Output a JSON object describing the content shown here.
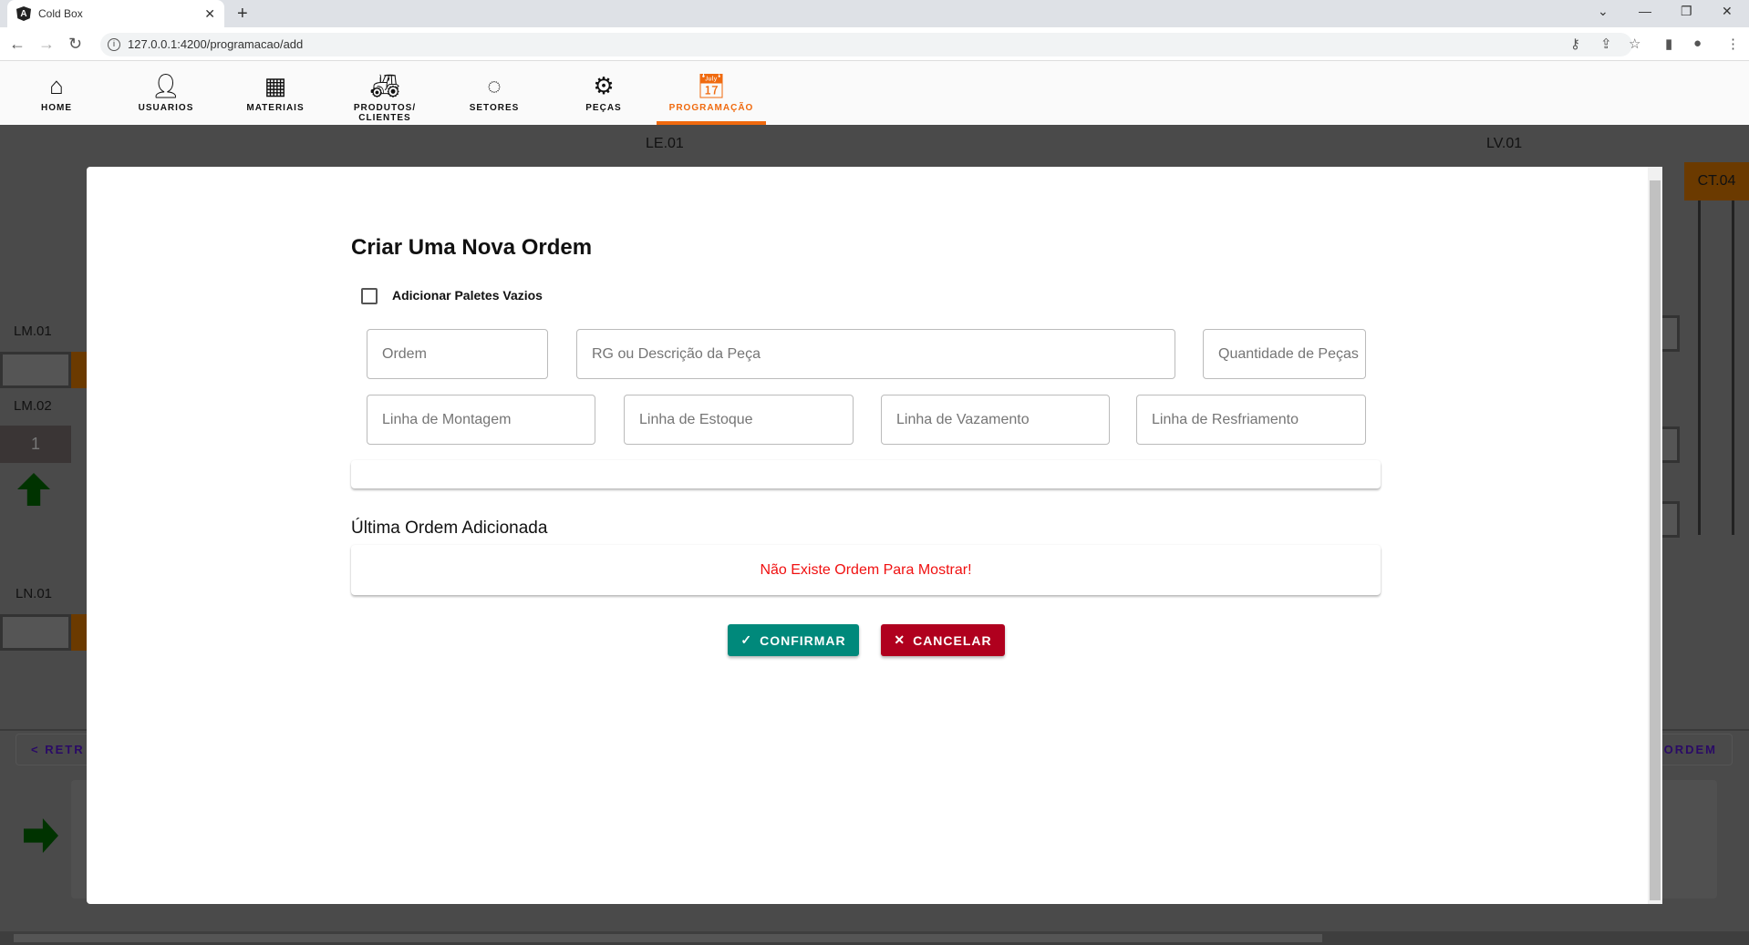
{
  "browser": {
    "tab_title": "Cold Box",
    "url": "127.0.0.1:4200/programacao/add",
    "new_tab": "+",
    "close_tab": "✕"
  },
  "nav": {
    "items": [
      {
        "label": "HOME",
        "icon": "home-icon"
      },
      {
        "label": "USUARIOS",
        "icon": "user-icon"
      },
      {
        "label": "MATERIAIS",
        "icon": "grid-icon"
      },
      {
        "label": "PRODUTOS/ CLIENTES",
        "icon": "machine-icon"
      },
      {
        "label": "SETORES",
        "icon": "sectors-icon"
      },
      {
        "label": "PEÇAS",
        "icon": "gears-icon"
      },
      {
        "label": "PROGRAMAÇÃO",
        "icon": "calendar-icon"
      }
    ],
    "active": "PROGRAMAÇÃO",
    "accent": "#f06a0f"
  },
  "background": {
    "le": "LE.01",
    "lv": "LV.01",
    "ct": "CT.04",
    "lm1": "LM.01",
    "lm2": "LM.02",
    "lm2_count": "1",
    "ln1": "LN.01",
    "retr": "< RETR",
    "ordem": "ORDEM"
  },
  "modal": {
    "title": "Criar Uma Nova Ordem",
    "checkbox_label": "Adicionar Paletes Vazios",
    "checkbox_checked": false,
    "fields": {
      "ordem": "Ordem",
      "rg": "RG ou Descrição da Peça",
      "qtd": "Quantidade de Peças",
      "montagem": "Linha de Montagem",
      "estoque": "Linha de Estoque",
      "vazamento": "Linha de Vazamento",
      "resfriamento": "Linha de Resfriamento"
    },
    "last_title": "Última Ordem Adicionada",
    "empty_message": "Não Existe Ordem Para Mostrar!",
    "confirm": "CONFIRMAR",
    "cancel": "CANCELAR",
    "confirm_color": "#00897b",
    "cancel_color": "#b0001e"
  }
}
